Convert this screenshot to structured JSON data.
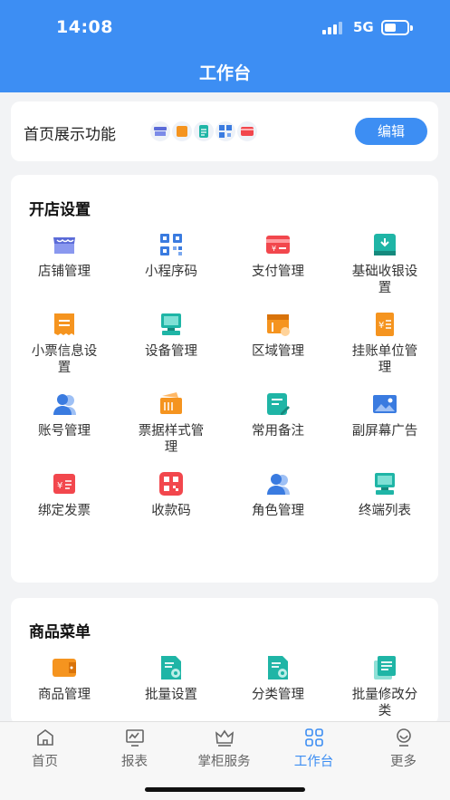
{
  "status": {
    "time": "14:08",
    "network": "5G"
  },
  "header": {
    "title": "工作台"
  },
  "display": {
    "label": "首页展示功能",
    "edit_label": "编辑",
    "mini_icons": [
      "store-icon",
      "ticket-icon",
      "list-icon",
      "qrcode-icon",
      "card-icon"
    ]
  },
  "shop": {
    "title": "开店设置",
    "items": [
      {
        "label": "店铺管理",
        "icon": "store-icon"
      },
      {
        "label": "小程序码",
        "icon": "qrcode-icon"
      },
      {
        "label": "支付管理",
        "icon": "payment-card-icon"
      },
      {
        "label": "基础收银设置",
        "icon": "cashier-icon"
      },
      {
        "label": "小票信息设置",
        "icon": "receipt-icon"
      },
      {
        "label": "设备管理",
        "icon": "device-icon"
      },
      {
        "label": "区域管理",
        "icon": "area-icon"
      },
      {
        "label": "挂账单位管理",
        "icon": "ledger-icon"
      },
      {
        "label": "账号管理",
        "icon": "user-icon"
      },
      {
        "label": "票据样式管理",
        "icon": "wallet-icon"
      },
      {
        "label": "常用备注",
        "icon": "note-icon"
      },
      {
        "label": "副屏幕广告",
        "icon": "image-icon"
      },
      {
        "label": "绑定发票",
        "icon": "invoice-icon"
      },
      {
        "label": "收款码",
        "icon": "payment-qrcode-icon"
      },
      {
        "label": "角色管理",
        "icon": "role-icon"
      },
      {
        "label": "终端列表",
        "icon": "terminal-icon"
      }
    ]
  },
  "goods": {
    "title": "商品菜单",
    "items": [
      {
        "label": "商品管理",
        "icon": "goods-icon"
      },
      {
        "label": "批量设置",
        "icon": "batch-setting-icon"
      },
      {
        "label": "分类管理",
        "icon": "category-icon"
      },
      {
        "label": "批量修改分类",
        "icon": "batch-edit-icon"
      }
    ]
  },
  "tabs": [
    {
      "label": "首页",
      "icon": "home-icon"
    },
    {
      "label": "报表",
      "icon": "report-icon"
    },
    {
      "label": "掌柜服务",
      "icon": "crown-icon"
    },
    {
      "label": "工作台",
      "icon": "workbench-icon"
    },
    {
      "label": "更多",
      "icon": "more-icon"
    }
  ],
  "colors": {
    "primary": "#3d8ef3",
    "teal": "#1fb5a6",
    "orange": "#f5941f",
    "red": "#f2474d",
    "blue": "#3a7be0"
  }
}
